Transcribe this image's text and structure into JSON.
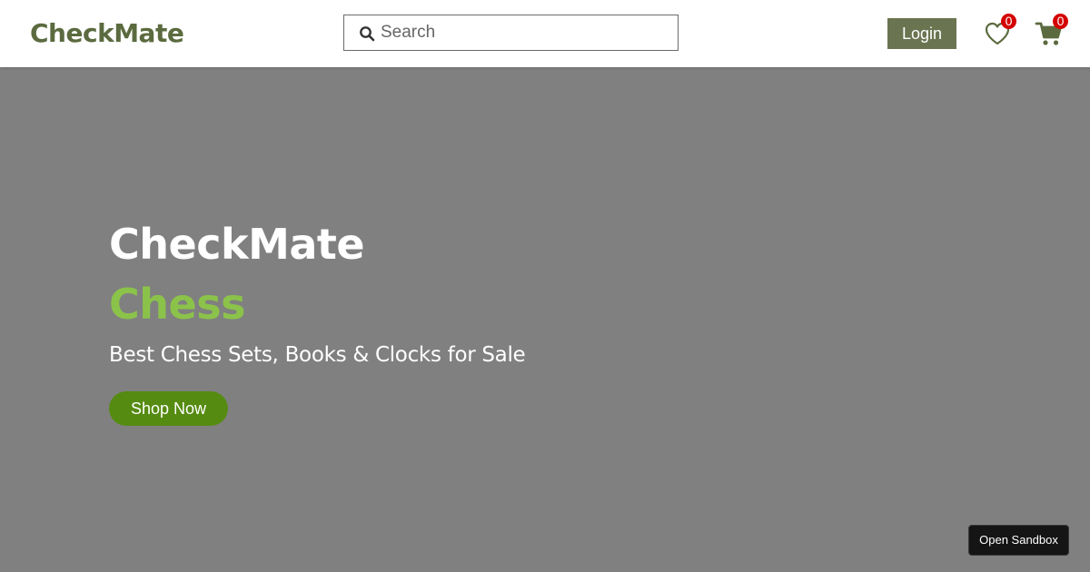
{
  "header": {
    "logo": "CheckMate",
    "search": {
      "placeholder": "Search",
      "value": "",
      "icon": "search-icon"
    },
    "login_label": "Login",
    "wishlist": {
      "icon": "heart-icon",
      "count": "0"
    },
    "cart": {
      "icon": "cart-icon",
      "count": "0"
    }
  },
  "hero": {
    "title": "CheckMate",
    "subtitle": "Chess",
    "tagline": "Best Chess Sets, Books & Clocks for Sale",
    "cta_label": "Shop Now"
  },
  "sandbox": {
    "label": "Open Sandbox"
  },
  "colors": {
    "brand": "#5b6b3f",
    "login_bg": "#6b7451",
    "accent_green": "#8bc34a",
    "cta_green": "#558b11",
    "badge_red": "#d40000",
    "hero_bg": "#808080"
  }
}
